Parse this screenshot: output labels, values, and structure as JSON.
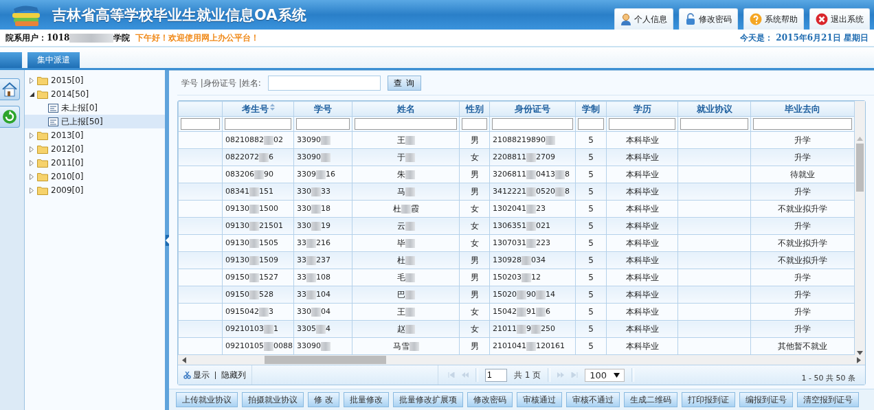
{
  "header": {
    "title": "吉林省高等学校毕业生就业信息OA系统",
    "nav": [
      {
        "label": "个人信息",
        "kind": "user"
      },
      {
        "label": "修改密码",
        "kind": "lock"
      },
      {
        "label": "系统帮助",
        "kind": "help"
      },
      {
        "label": "退出系统",
        "kind": "exit"
      }
    ]
  },
  "info_bar": {
    "user_label": "院系用户：",
    "user_value": [
      "1018",
      "学院"
    ],
    "greeting": "下午好！欢迎使用网上办公平台！",
    "date": "今天是：  2015年6月21日  星期日"
  },
  "tabs": [
    {
      "label": "集中派遣",
      "selected": true
    }
  ],
  "tree": [
    {
      "label": "2015[0]",
      "expanded": false,
      "selected": false
    },
    {
      "label": "2014[50]",
      "expanded": true,
      "selected": false,
      "children": [
        {
          "label": "未上报[0]",
          "selected": false
        },
        {
          "label": "已上报[50]",
          "selected": true
        }
      ]
    },
    {
      "label": "2013[0]",
      "expanded": false,
      "selected": false
    },
    {
      "label": "2012[0]",
      "expanded": false,
      "selected": false
    },
    {
      "label": "2011[0]",
      "expanded": false,
      "selected": false
    },
    {
      "label": "2010[0]",
      "expanded": false,
      "selected": false
    },
    {
      "label": "2009[0]",
      "expanded": false,
      "selected": false
    }
  ],
  "search": {
    "label": "学号 |身份证号 |姓名:",
    "button": "查 询"
  },
  "table": {
    "columns": [
      {
        "label": "考生号",
        "sorted": true
      },
      {
        "label": "学号",
        "sorted": false
      },
      {
        "label": "姓名",
        "sorted": false
      },
      {
        "label": "性别",
        "sorted": false
      },
      {
        "label": "身份证号",
        "sorted": false
      },
      {
        "label": "学制",
        "sorted": false
      },
      {
        "label": "学历",
        "sorted": false
      },
      {
        "label": "就业协议",
        "sorted": false
      },
      {
        "label": "毕业去向",
        "sorted": false
      }
    ],
    "rows": [
      [
        [
          "08210882",
          "02"
        ],
        [
          "33090"
        ],
        [
          "王"
        ],
        "男",
        [
          "21088219890"
        ],
        "5",
        "本科毕业",
        "",
        "升学"
      ],
      [
        [
          "0822072",
          "6"
        ],
        [
          "33090"
        ],
        [
          "于"
        ],
        "女",
        [
          "2208811",
          "2709"
        ],
        "5",
        "本科毕业",
        "",
        "升学"
      ],
      [
        [
          "083206",
          "90"
        ],
        [
          "3309",
          "16"
        ],
        [
          "朱"
        ],
        "男",
        [
          "3206811",
          "0413",
          "8"
        ],
        "5",
        "本科毕业",
        "",
        "待就业"
      ],
      [
        [
          "08341",
          "151"
        ],
        [
          "330",
          "33"
        ],
        [
          "马"
        ],
        "男",
        [
          "3412221",
          "0520",
          "8"
        ],
        "5",
        "本科毕业",
        "",
        "升学"
      ],
      [
        [
          "09130",
          "1500"
        ],
        [
          "330",
          "18"
        ],
        [
          "杜",
          "霞"
        ],
        "女",
        [
          "1302041",
          "23"
        ],
        "5",
        "本科毕业",
        "",
        "不就业拟升学"
      ],
      [
        [
          "09130",
          "21501"
        ],
        [
          "330",
          "19"
        ],
        [
          "云"
        ],
        "女",
        [
          "1306351",
          "021"
        ],
        "5",
        "本科毕业",
        "",
        "升学"
      ],
      [
        [
          "09130",
          "1505"
        ],
        [
          "33",
          "216"
        ],
        [
          "毕"
        ],
        "女",
        [
          "1307031",
          "223"
        ],
        "5",
        "本科毕业",
        "",
        "不就业拟升学"
      ],
      [
        [
          "09130",
          "1509"
        ],
        [
          "33",
          "237"
        ],
        [
          "杜"
        ],
        "男",
        [
          "130928",
          "034"
        ],
        "5",
        "本科毕业",
        "",
        "不就业拟升学"
      ],
      [
        [
          "09150",
          "1527"
        ],
        [
          "33",
          "108"
        ],
        [
          "毛"
        ],
        "男",
        [
          "150203",
          "12"
        ],
        "5",
        "本科毕业",
        "",
        "升学"
      ],
      [
        [
          "09150",
          "528"
        ],
        [
          "33",
          "104"
        ],
        [
          "巴"
        ],
        "男",
        [
          "15020",
          "90",
          "14"
        ],
        "5",
        "本科毕业",
        "",
        "升学"
      ],
      [
        [
          "0915042",
          "3"
        ],
        [
          "330",
          "04"
        ],
        [
          "王"
        ],
        "女",
        [
          "15042",
          "91",
          "6"
        ],
        "5",
        "本科毕业",
        "",
        "升学"
      ],
      [
        [
          "09210103",
          "1"
        ],
        [
          "3305",
          "4"
        ],
        [
          "赵"
        ],
        "女",
        [
          "21011",
          "9",
          "250"
        ],
        "5",
        "本科毕业",
        "",
        "升学"
      ],
      [
        [
          "09210105",
          "0088"
        ],
        [
          "33090"
        ],
        [
          "马雪"
        ],
        "男",
        [
          "2101041",
          "120161"
        ],
        "5",
        "本科毕业",
        "",
        "其他暂不就业"
      ]
    ]
  },
  "grid_footer": {
    "show": "显示",
    "hide": "隐藏列",
    "page": "1",
    "page_total": "共 1 页",
    "page_size": "100",
    "summary": "1 - 50   共 50 条"
  },
  "actions": [
    "上传就业协议",
    "拍摄就业协议",
    "修 改",
    "批量修改",
    "批量修改扩展项",
    "修改密码",
    "审核通过",
    "审核不通过",
    "生成二维码",
    "打印报到证",
    "编报到证号",
    "清空报到证号"
  ]
}
